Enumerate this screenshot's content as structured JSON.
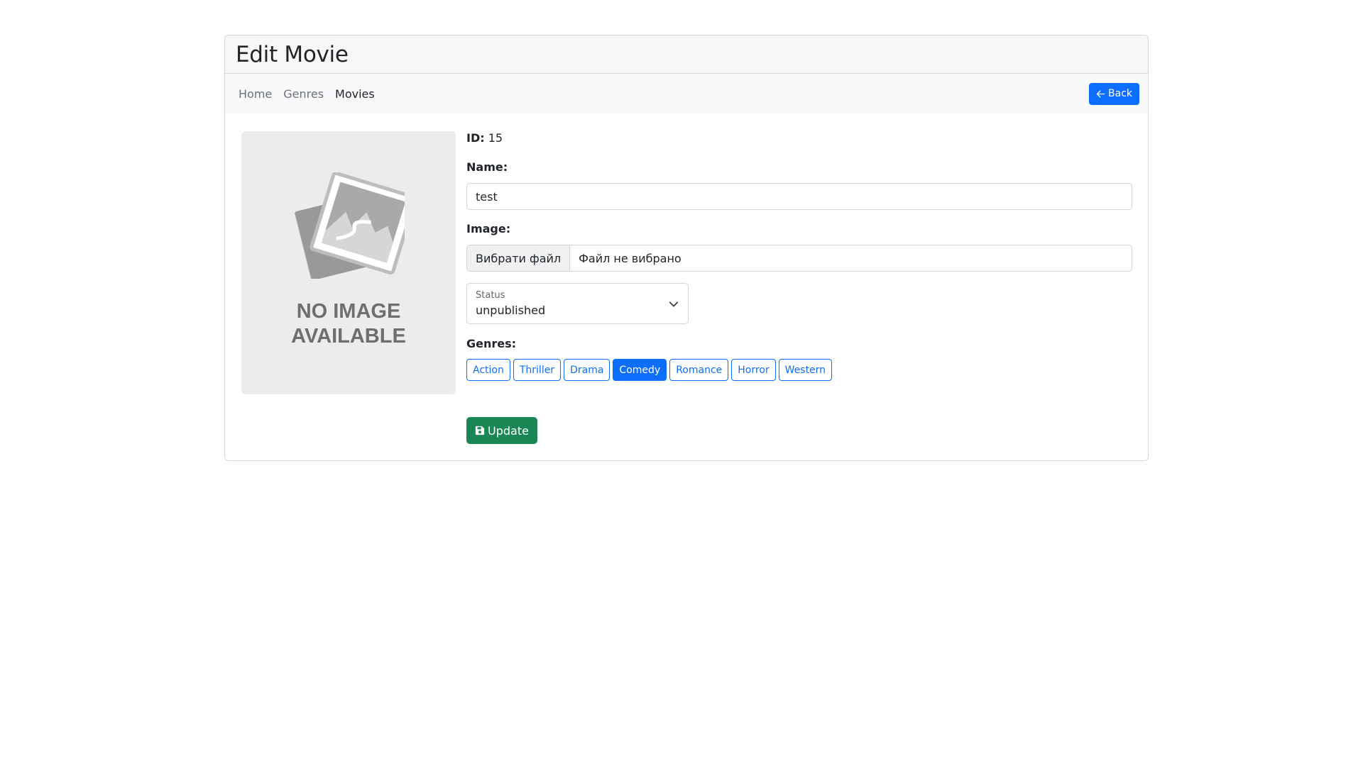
{
  "header": {
    "title": "Edit Movie"
  },
  "nav": {
    "items": [
      {
        "label": "Home",
        "active": false
      },
      {
        "label": "Genres",
        "active": false
      },
      {
        "label": "Movies",
        "active": true
      }
    ],
    "back_label": "Back"
  },
  "image_placeholder": {
    "line1": "NO IMAGE",
    "line2": "AVAILABLE"
  },
  "form": {
    "id_label": "ID:",
    "id_value": "15",
    "name_label": "Name:",
    "name_value": "test",
    "image_label": "Image:",
    "file_button_label": "Вибрати файл",
    "file_status": "Файл не вибрано",
    "status_label": "Status",
    "status_value": "unpublished",
    "genres_label": "Genres:",
    "genres": [
      {
        "label": "Action",
        "selected": false
      },
      {
        "label": "Thriller",
        "selected": false
      },
      {
        "label": "Drama",
        "selected": false
      },
      {
        "label": "Comedy",
        "selected": true
      },
      {
        "label": "Romance",
        "selected": false
      },
      {
        "label": "Horror",
        "selected": false
      },
      {
        "label": "Western",
        "selected": false
      }
    ],
    "update_label": "Update"
  },
  "colors": {
    "primary": "#0d6efd",
    "success": "#198754",
    "placeholder_bg": "#ececec"
  }
}
